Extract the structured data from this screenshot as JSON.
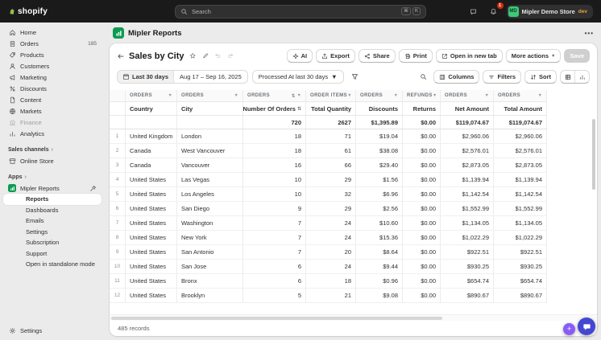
{
  "topbar": {
    "logo_text": "shopify",
    "search_placeholder": "Search",
    "shortcut_mod": "⌘",
    "shortcut_key": "K",
    "notification_count": "1",
    "store": {
      "name": "Mipler Demo Store",
      "env": "dev",
      "initials": "MD"
    }
  },
  "sidebar": {
    "items": [
      {
        "label": "Home"
      },
      {
        "label": "Orders",
        "badge": "185"
      },
      {
        "label": "Products"
      },
      {
        "label": "Customers"
      },
      {
        "label": "Marketing"
      },
      {
        "label": "Discounts"
      },
      {
        "label": "Content"
      },
      {
        "label": "Markets"
      },
      {
        "label": "Finance"
      },
      {
        "label": "Analytics"
      }
    ],
    "sales_channels_label": "Sales channels",
    "online_store_label": "Online Store",
    "apps_label": "Apps",
    "app_name": "Mipler Reports",
    "app_subitems": [
      {
        "label": "Reports",
        "selected": true
      },
      {
        "label": "Dashboards"
      },
      {
        "label": "Emails"
      },
      {
        "label": "Settings"
      },
      {
        "label": "Subscription"
      },
      {
        "label": "Support"
      },
      {
        "label": "Open in standalone mode"
      }
    ],
    "settings_label": "Settings"
  },
  "app_header": {
    "title": "Mipler Reports",
    "menu": "•••"
  },
  "report_header": {
    "title": "Sales by City",
    "buttons": {
      "ai": "AI",
      "export": "Export",
      "share": "Share",
      "print": "Print",
      "open_new_tab": "Open in new tab",
      "more_actions": "More actions",
      "save": "Save"
    }
  },
  "filter_bar": {
    "date_preset": "Last 30 days",
    "date_range": "Aug 17 – Sep 16, 2025",
    "processed_at": "Processed At last 30 days",
    "columns": "Columns",
    "filters": "Filters",
    "sort": "Sort"
  },
  "table": {
    "groups": [
      {
        "label": "ORDERS"
      },
      {
        "label": "ORDERS"
      },
      {
        "label": "ORDERS",
        "sorted": true
      },
      {
        "label": "ORDER ITEMS"
      },
      {
        "label": "ORDERS"
      },
      {
        "label": "REFUNDS"
      },
      {
        "label": "ORDERS"
      },
      {
        "label": "ORDERS"
      }
    ],
    "columns": [
      {
        "label": "Country"
      },
      {
        "label": "City"
      },
      {
        "label": "Number Of Orders",
        "sorted": true
      },
      {
        "label": "Total Quantity"
      },
      {
        "label": "Discounts"
      },
      {
        "label": "Returns"
      },
      {
        "label": "Net Amount"
      },
      {
        "label": "Total Amount"
      }
    ],
    "totals": [
      "",
      "",
      "720",
      "2627",
      "$1,395.89",
      "$0.00",
      "$119,074.67",
      "$119,074.67"
    ],
    "rows": [
      [
        "United Kingdom",
        "London",
        "18",
        "71",
        "$19.04",
        "$0.00",
        "$2,960.06",
        "$2,960.06"
      ],
      [
        "Canada",
        "West Vancouver",
        "18",
        "61",
        "$38.08",
        "$0.00",
        "$2,576.01",
        "$2,576.01"
      ],
      [
        "Canada",
        "Vancouver",
        "16",
        "66",
        "$29.40",
        "$0.00",
        "$2,873.05",
        "$2,873.05"
      ],
      [
        "United States",
        "Las Vegas",
        "10",
        "29",
        "$1.56",
        "$0.00",
        "$1,139.94",
        "$1,139.94"
      ],
      [
        "United States",
        "Los Angeles",
        "10",
        "32",
        "$6.96",
        "$0.00",
        "$1,142.54",
        "$1,142.54"
      ],
      [
        "United States",
        "San Diego",
        "9",
        "29",
        "$2.56",
        "$0.00",
        "$1,552.99",
        "$1,552.99"
      ],
      [
        "United States",
        "Washington",
        "7",
        "24",
        "$10.60",
        "$0.00",
        "$1,134.05",
        "$1,134.05"
      ],
      [
        "United States",
        "New York",
        "7",
        "24",
        "$15.36",
        "$0.00",
        "$1,022.29",
        "$1,022.29"
      ],
      [
        "United States",
        "San Antonio",
        "7",
        "20",
        "$8.64",
        "$0.00",
        "$922.51",
        "$922.51"
      ],
      [
        "United States",
        "San Jose",
        "6",
        "24",
        "$9.44",
        "$0.00",
        "$930.25",
        "$930.25"
      ],
      [
        "United States",
        "Bronx",
        "6",
        "18",
        "$0.96",
        "$0.00",
        "$654.74",
        "$654.74"
      ],
      [
        "United States",
        "Brooklyn",
        "5",
        "21",
        "$9.08",
        "$0.00",
        "$890.67",
        "$890.67"
      ]
    ],
    "records_label": "485 records"
  },
  "colors": {
    "topbar": "#1a1a1a",
    "app_icon_green": "#0c9b51",
    "notification_red": "#d82c0d",
    "env_badge_orange": "#e8a23d",
    "launcher_blue": "#4347d2",
    "launcher_purple": "#8a5cf6"
  }
}
